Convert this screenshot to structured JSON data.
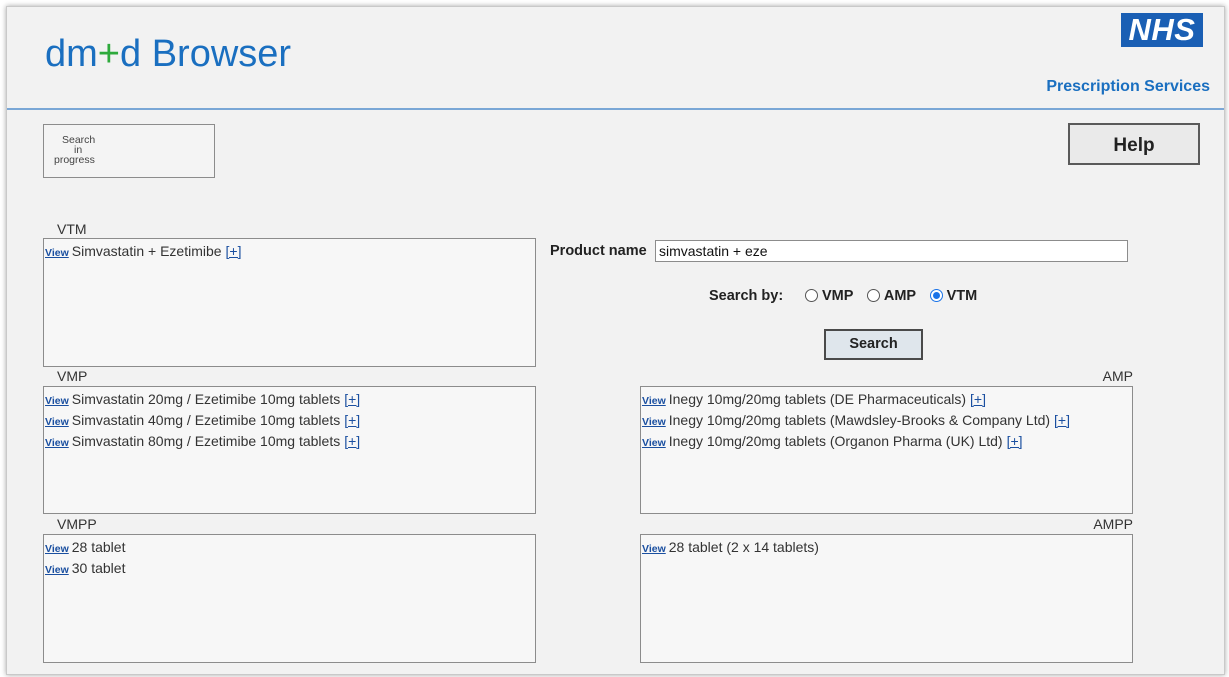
{
  "header": {
    "title_part1": "dm",
    "title_plus": "+",
    "title_part2": "d Browser",
    "logo_text": "NHS",
    "logo_subtitle": "Prescription Services"
  },
  "status": {
    "line1": "Search",
    "line2": "in",
    "line3": "progress"
  },
  "help_label": "Help",
  "search": {
    "product_label": "Product name",
    "product_value": "simvastatin + eze",
    "search_by_label": "Search by:",
    "options": [
      "VMP",
      "AMP",
      "VTM"
    ],
    "selected": "VTM",
    "button_label": "Search"
  },
  "view_link": "View",
  "expand_link": "[+]",
  "vtm": {
    "label": "VTM",
    "items": [
      {
        "text": "Simvastatin + Ezetimibe",
        "expand": "[+]"
      }
    ]
  },
  "vmp": {
    "label": "VMP",
    "items": [
      {
        "text": "Simvastatin 20mg / Ezetimibe 10mg tablets",
        "expand": "[+]"
      },
      {
        "text": "Simvastatin 40mg / Ezetimibe 10mg tablets",
        "expand": "[+]"
      },
      {
        "text": "Simvastatin 80mg / Ezetimibe 10mg tablets",
        "expand": "[+]"
      }
    ]
  },
  "amp": {
    "label": "AMP",
    "items": [
      {
        "text": "Inegy 10mg/20mg tablets (DE Pharmaceuticals)",
        "expand": "[+]"
      },
      {
        "text": "Inegy 10mg/20mg tablets (Mawdsley-Brooks & Company Ltd)",
        "expand": "[+]"
      },
      {
        "text": "Inegy 10mg/20mg tablets (Organon Pharma (UK) Ltd)",
        "expand": "[+]"
      }
    ]
  },
  "vmpp": {
    "label": "VMPP",
    "items": [
      {
        "text": "28 tablet"
      },
      {
        "text": "30 tablet"
      }
    ]
  },
  "ampp": {
    "label": "AMPP",
    "items": [
      {
        "text": "28 tablet (2 x 14 tablets)"
      }
    ]
  },
  "colors": {
    "title_blue": "#1a6fc0",
    "title_plus_green": "#2eaa3c",
    "nhs_blue": "#1a5fb4",
    "link_blue": "#1a4fa0",
    "background": "#f2f2f2"
  }
}
